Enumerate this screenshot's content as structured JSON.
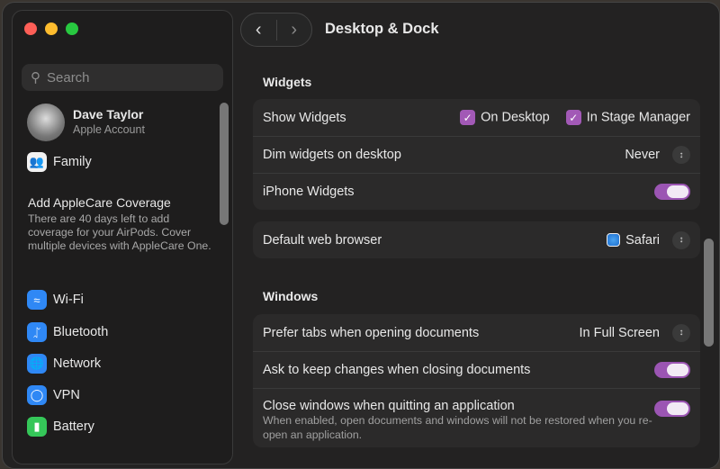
{
  "window": {
    "title": "Desktop & Dock"
  },
  "sidebar": {
    "search_placeholder": "Search",
    "account": {
      "name": "Dave Taylor",
      "subtitle": "Apple Account"
    },
    "family": "Family",
    "applecare": {
      "title": "Add AppleCare Coverage",
      "body": "There are 40 days left to add coverage for your AirPods. Cover multiple devices with AppleCare One."
    },
    "items": [
      {
        "label": "Wi-Fi",
        "icon": "wifi-icon",
        "color": "#2f88f5"
      },
      {
        "label": "Bluetooth",
        "icon": "bluetooth-icon",
        "color": "#2f88f5"
      },
      {
        "label": "Network",
        "icon": "globe-icon",
        "color": "#2f88f5"
      },
      {
        "label": "VPN",
        "icon": "vpn-icon",
        "color": "#2f88f5"
      },
      {
        "label": "Battery",
        "icon": "battery-icon",
        "color": "#35c759"
      }
    ]
  },
  "widgets": {
    "heading": "Widgets",
    "show_widgets": {
      "label": "Show Widgets",
      "on_desktop": "On Desktop",
      "in_stage_manager": "In Stage Manager",
      "on_desktop_checked": true,
      "in_stage_manager_checked": true
    },
    "dim": {
      "label": "Dim widgets on desktop",
      "value": "Never"
    },
    "iphone": {
      "label": "iPhone Widgets",
      "on": true
    }
  },
  "browser": {
    "label": "Default web browser",
    "value": "Safari"
  },
  "windows": {
    "heading": "Windows",
    "prefer_tabs": {
      "label": "Prefer tabs when opening documents",
      "value": "In Full Screen"
    },
    "ask_keep": {
      "label": "Ask to keep changes when closing documents",
      "on": true
    },
    "close_windows": {
      "label": "Close windows when quitting an application",
      "description": "When enabled, open documents and windows will not be restored when you re-open an application.",
      "on": true
    }
  },
  "colors": {
    "accent": "#9b55b3"
  }
}
